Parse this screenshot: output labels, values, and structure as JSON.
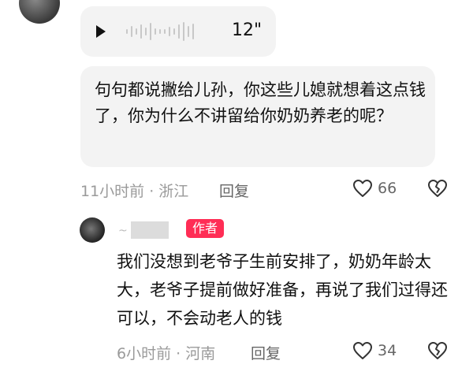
{
  "comment1": {
    "voice": {
      "duration": "12\""
    },
    "text": "句句都说撇给儿孙，你这些儿媳就想着这点钱了，你为什么不讲留给你奶奶养老的呢？",
    "time_location": "11小时前 · 浙江",
    "reply_label": "回复",
    "likes": "66"
  },
  "comment2": {
    "author_badge": "作者",
    "name_mark": "~",
    "text": "我们没想到老爷子生前安排了，奶奶年龄太大，老爷子提前做好准备，再说了我们过得还可以，不会动老人的钱",
    "time_location": "6小时前 · 河南",
    "reply_label": "回复",
    "likes": "34"
  },
  "icons": {
    "play": "play-icon",
    "like": "heart-icon",
    "dislike": "broken-heart-icon"
  }
}
